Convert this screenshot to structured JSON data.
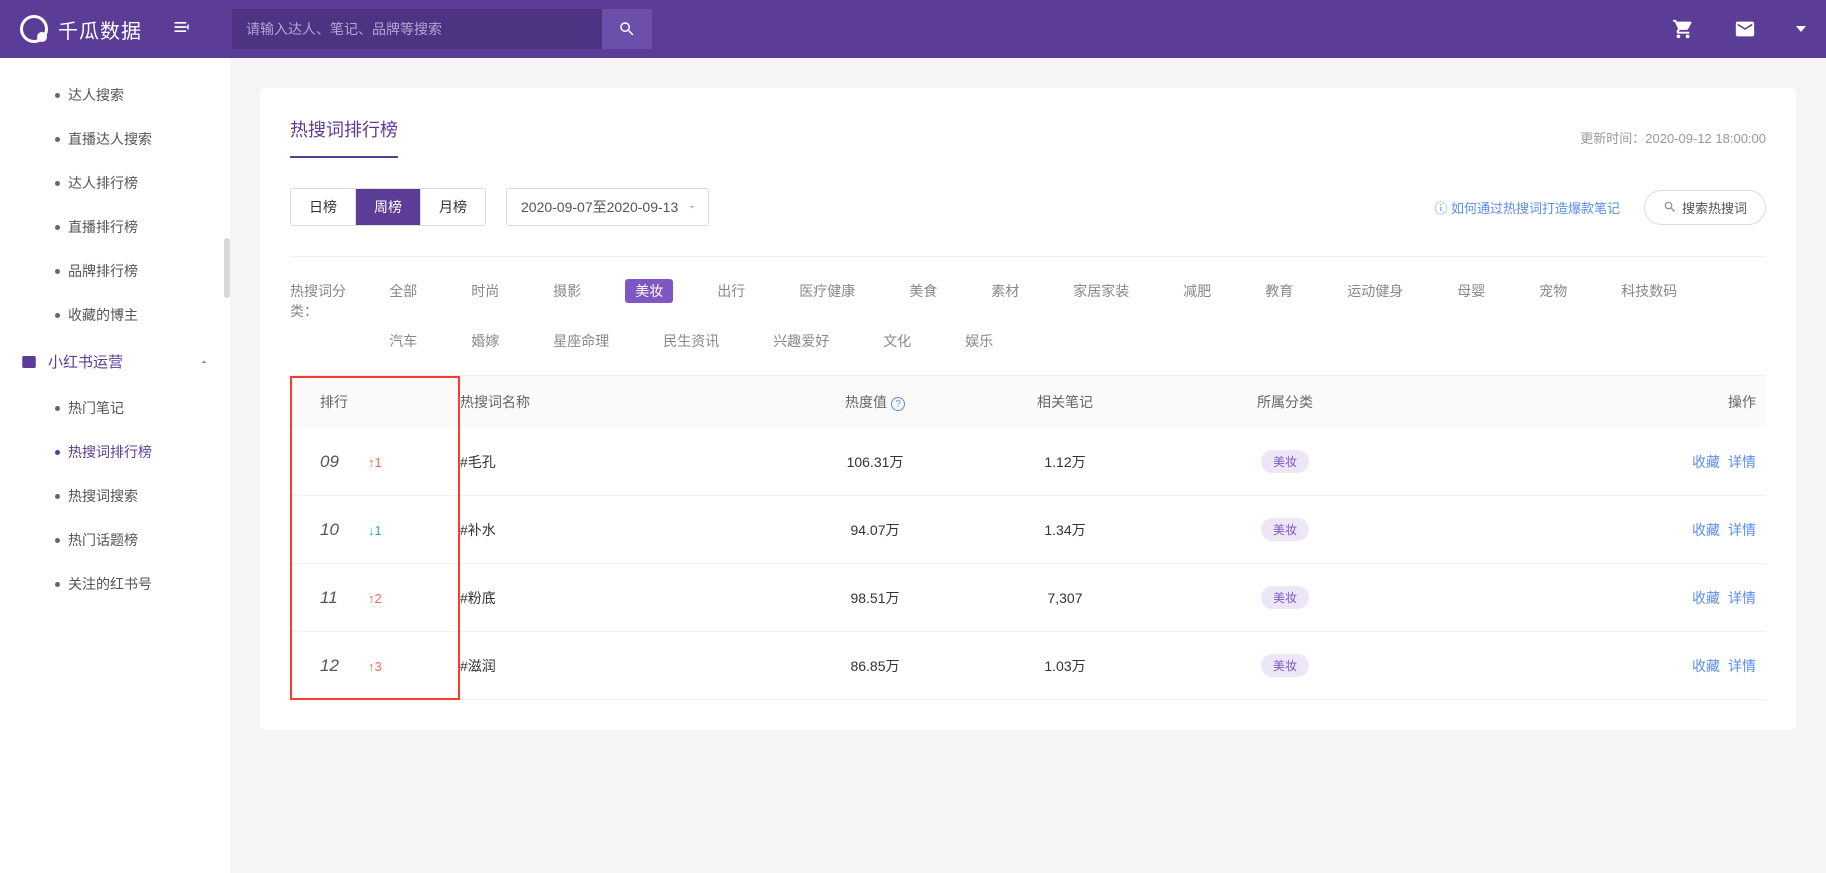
{
  "brand": "千瓜数据",
  "search": {
    "placeholder": "请输入达人、笔记、品牌等搜索"
  },
  "sidebar": {
    "top_items": [
      "达人搜索",
      "直播达人搜索",
      "达人排行榜",
      "直播排行榜",
      "品牌排行榜",
      "收藏的博主"
    ],
    "category": "小红书运营",
    "sub_items": [
      "热门笔记",
      "热搜词排行榜",
      "热搜词搜索",
      "热门话题榜",
      "关注的红书号"
    ],
    "active_sub": 1
  },
  "page": {
    "title": "热搜词排行榜",
    "update_label": "更新时间：",
    "update_time": "2020-09-12 18:00:00"
  },
  "tabs": {
    "items": [
      "日榜",
      "周榜",
      "月榜"
    ],
    "active": 1
  },
  "date_range": "2020-09-07至2020-09-13",
  "help_link": "如何通过热搜词打造爆款笔记",
  "search_btn_label": "搜索热搜词",
  "filter": {
    "label": "热搜词分类：",
    "tags": [
      "全部",
      "时尚",
      "摄影",
      "美妆",
      "出行",
      "医疗健康",
      "美食",
      "素材",
      "家居家装",
      "减肥",
      "教育",
      "运动健身",
      "母婴",
      "宠物",
      "科技数码",
      "汽车",
      "婚嫁",
      "星座命理",
      "民生资讯",
      "兴趣爱好",
      "文化",
      "娱乐"
    ],
    "active": 3
  },
  "table": {
    "headers": {
      "rank": "排行",
      "name": "热搜词名称",
      "heat": "热度值",
      "notes": "相关笔记",
      "category": "所属分类",
      "ops": "操作"
    },
    "ops_labels": {
      "fav": "收藏",
      "detail": "详情"
    },
    "rows": [
      {
        "rank": "09",
        "delta_dir": "up",
        "delta": "1",
        "name": "#毛孔",
        "heat": "106.31万",
        "notes": "1.12万",
        "category": "美妆"
      },
      {
        "rank": "10",
        "delta_dir": "down",
        "delta": "1",
        "name": "#补水",
        "heat": "94.07万",
        "notes": "1.34万",
        "category": "美妆"
      },
      {
        "rank": "11",
        "delta_dir": "up",
        "delta": "2",
        "name": "#粉底",
        "heat": "98.51万",
        "notes": "7,307",
        "category": "美妆"
      },
      {
        "rank": "12",
        "delta_dir": "up",
        "delta": "3",
        "name": "#滋润",
        "heat": "86.85万",
        "notes": "1.03万",
        "category": "美妆"
      }
    ]
  }
}
